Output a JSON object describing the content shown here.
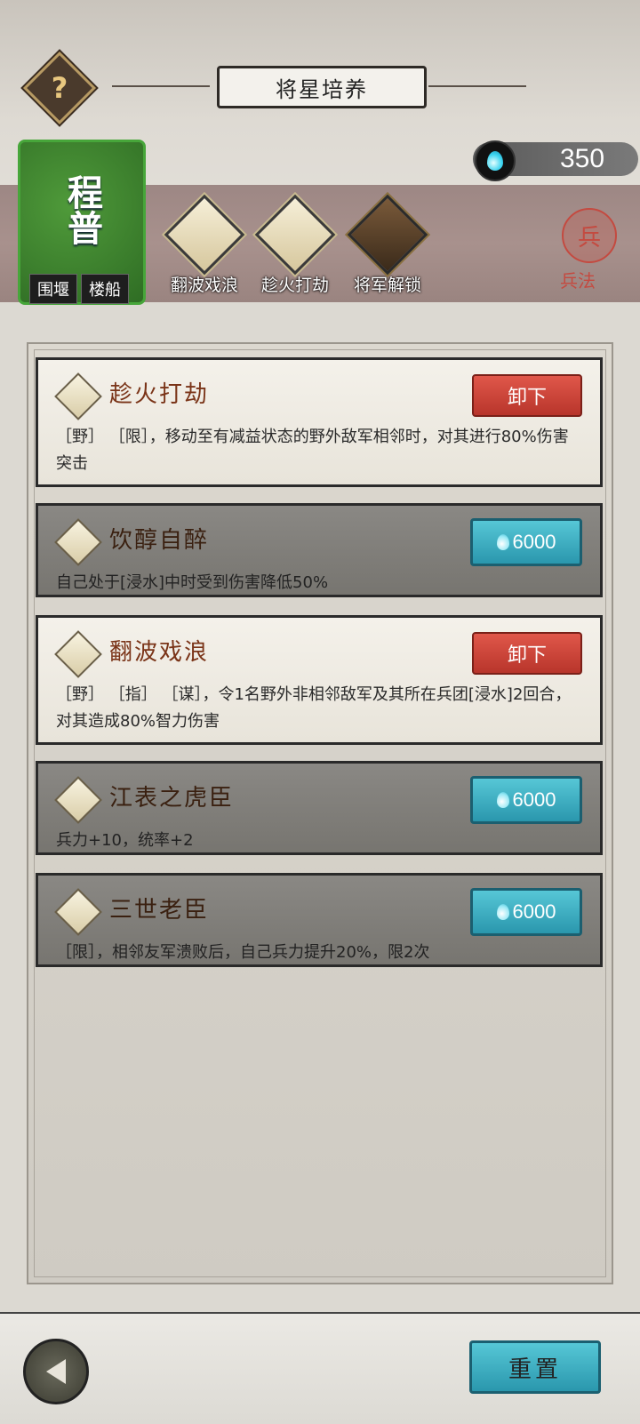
{
  "header": {
    "title": "将星培养",
    "help_icon": "?"
  },
  "resource": {
    "icon": "water-drop-icon",
    "value": "350"
  },
  "hero": {
    "name": "程普",
    "tags": [
      "围堰",
      "楼船"
    ]
  },
  "equipped_chips": [
    {
      "label": "翻波戏浪",
      "icon": "skill-diamond-icon"
    },
    {
      "label": "趁火打劫",
      "icon": "skill-diamond-icon"
    },
    {
      "label": "将军解锁",
      "icon": "lock-diamond-icon"
    }
  ],
  "bingfa": {
    "glyph": "兵",
    "label": "兵法"
  },
  "skills": [
    {
      "title": "趁火打劫",
      "state": "equipped",
      "action": "卸下",
      "desc": "［野］ ［限］，移动至有减益状态的野外敌军相邻时，对其进行80%伤害 突击"
    },
    {
      "title": "饮醇自醉",
      "state": "locked",
      "action": "6000",
      "desc": "自己处于[浸水]中时受到伤害降低50%"
    },
    {
      "title": "翻波戏浪",
      "state": "equipped",
      "action": "卸下",
      "desc": "［野］ ［指］ ［谋］，令1名野外非相邻敌军及其所在兵团[浸水]2回合，对其造成80%智力伤害"
    },
    {
      "title": "江表之虎臣",
      "state": "locked",
      "action": "6000",
      "desc": "兵力+10，统率+2"
    },
    {
      "title": "三世老臣",
      "state": "locked",
      "action": "6000",
      "desc": "［限］，相邻友军溃败后，自己兵力提升20%，限2次"
    }
  ],
  "footer": {
    "reset_label": "重置"
  },
  "colors": {
    "equip_red": "#c9443a",
    "buy_cyan": "#3fb3c6",
    "hero_green": "#47a63a"
  }
}
